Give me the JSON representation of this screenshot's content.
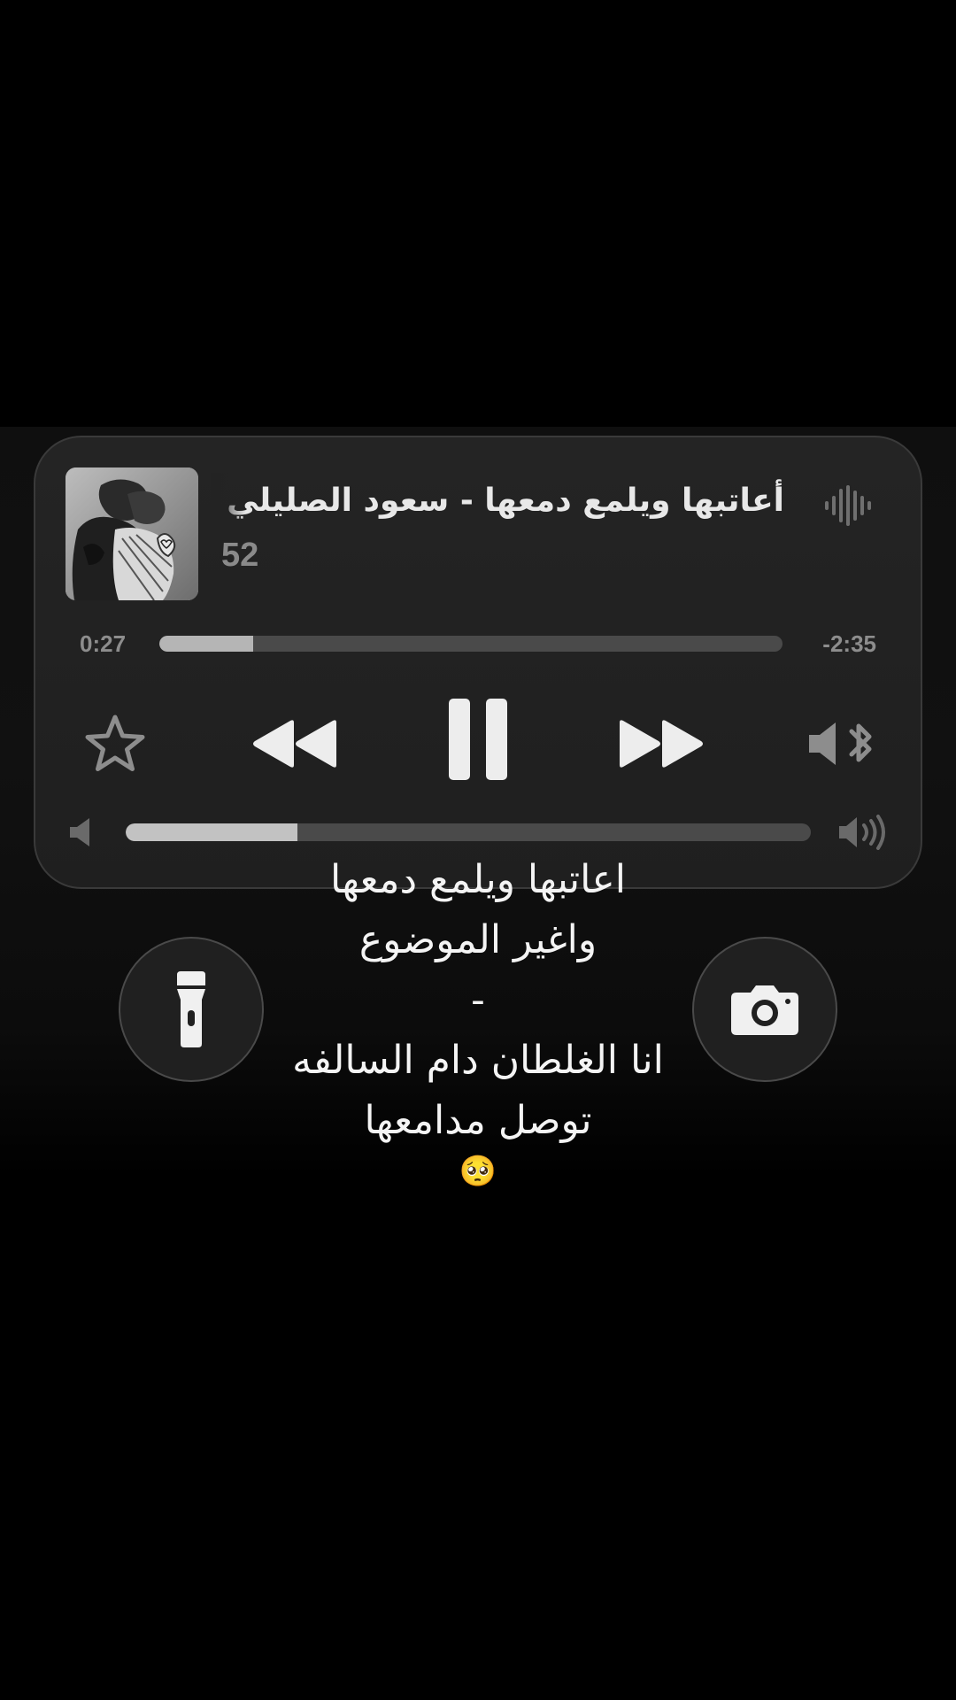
{
  "now_playing": {
    "title": "أعاتبها ويلمع دمعها - سعود الصليلي",
    "artist": "52",
    "elapsed": "0:27",
    "remaining": "-2:35",
    "progress": 0.15,
    "volume": 0.25,
    "artwork_icon": "album-art-sketch",
    "waveform_icon": "waveform-icon"
  },
  "controls": {
    "favorite_icon": "star-icon",
    "previous_icon": "rewind-icon",
    "playpause_icon": "pause-icon",
    "next_icon": "fast-forward-icon",
    "output_icon": "bluetooth-speaker-icon"
  },
  "quick_actions": {
    "flashlight_icon": "flashlight-icon",
    "camera_icon": "camera-icon"
  },
  "lyrics": {
    "line1": "اعاتبها ويلمع دمعها",
    "line2": "واغير الموضوع",
    "line3": "-",
    "line4": "انا الغلطان دام السالفه",
    "line5": "توصل مدامعها",
    "emoji": "🥺"
  },
  "colors": {
    "background": "#000000",
    "player_bg": "#232323",
    "track_bg": "#4a4a4a",
    "track_fill": "#b5b5b5",
    "text_primary": "#e8e8e8",
    "text_secondary": "#8a8a8a"
  }
}
